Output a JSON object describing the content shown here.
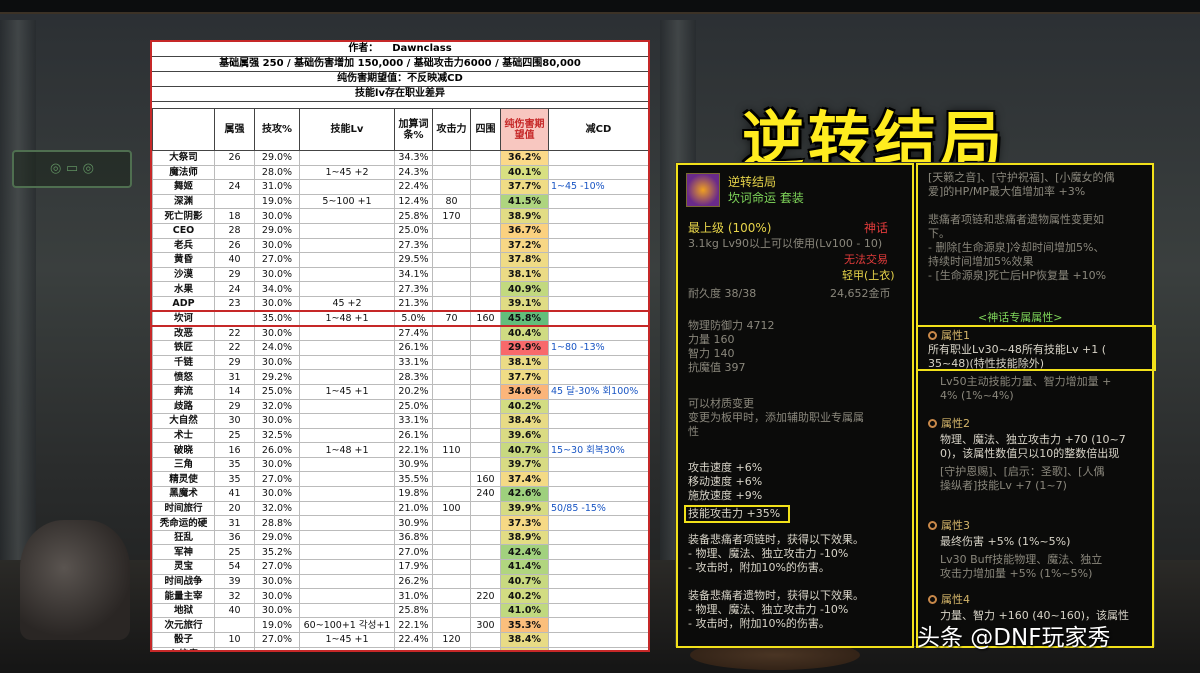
{
  "title": "逆转结局",
  "watermark": "头条 @DNF玩家秀",
  "background": {
    "sign": "◎ ▭ ◎"
  },
  "sheet": {
    "author_label": "作者：",
    "author": "Dawnclass",
    "base_line": "基础属强  250 / 基础伤害增加 150,000 / 基础攻击力6000 / 基础四围80,000",
    "pure_line": "纯伤害期望值：不反映减CD",
    "note_line": "技能lv存在职业差异",
    "columns": [
      "",
      "属强",
      "技攻%",
      "技能Lv",
      "加算词条%",
      "攻击力",
      "四围",
      "纯伤害期望值",
      "减CD"
    ],
    "rows": [
      {
        "name": "大祭司",
        "c": [
          "26",
          "29.0%",
          "",
          "34.3%",
          "",
          "",
          "36.2%",
          ""
        ],
        "color": "#fbd989"
      },
      {
        "name": "魔法师",
        "c": [
          "",
          "28.0%",
          "1~45 +2",
          "24.3%",
          "",
          "",
          "40.1%",
          ""
        ],
        "color": "#d8e081"
      },
      {
        "name": "舞姬",
        "c": [
          "24",
          "31.0%",
          "",
          "22.4%",
          "",
          "",
          "37.7%",
          "1~45 -10%"
        ],
        "color": "#f0dc85"
      },
      {
        "name": "深渊",
        "c": [
          "",
          "19.0%",
          "5~100 +1",
          "12.4%",
          "80",
          "",
          "41.5%",
          ""
        ],
        "color": "#aed57f"
      },
      {
        "name": "死亡阴影",
        "c": [
          "18",
          "30.0%",
          "",
          "25.8%",
          "170",
          "",
          "38.9%",
          ""
        ],
        "color": "#e2dc84"
      },
      {
        "name": "CEO",
        "c": [
          "28",
          "29.0%",
          "",
          "25.0%",
          "",
          "",
          "36.7%",
          ""
        ],
        "color": "#fbd17f"
      },
      {
        "name": "老兵",
        "c": [
          "26",
          "30.0%",
          "",
          "27.3%",
          "",
          "",
          "37.2%",
          ""
        ],
        "color": "#f8d785"
      },
      {
        "name": "黄昏",
        "c": [
          "40",
          "27.0%",
          "",
          "29.5%",
          "",
          "",
          "37.8%",
          ""
        ],
        "color": "#efdb85"
      },
      {
        "name": "沙漠",
        "c": [
          "29",
          "30.0%",
          "",
          "34.1%",
          "",
          "",
          "38.1%",
          ""
        ],
        "color": "#ebdb85"
      },
      {
        "name": "水果",
        "c": [
          "24",
          "34.0%",
          "",
          "27.3%",
          "",
          "",
          "40.9%",
          ""
        ],
        "color": "#c2d97f"
      },
      {
        "name": "ADP",
        "c": [
          "23",
          "30.0%",
          "45 +2",
          "21.3%",
          "",
          "",
          "39.1%",
          ""
        ],
        "color": "#e0dc84"
      },
      {
        "name": "坎诃",
        "c": [
          "",
          "35.0%",
          "1~48 +1",
          "5.0%",
          "70",
          "160",
          "45.8%",
          ""
        ],
        "color": "#63be7b",
        "hl": true
      },
      {
        "name": "改恶",
        "c": [
          "22",
          "30.0%",
          "",
          "27.4%",
          "",
          "",
          "40.4%",
          ""
        ],
        "color": "#cfdb82"
      },
      {
        "name": "铁匠",
        "c": [
          "22",
          "24.0%",
          "",
          "26.1%",
          "",
          "",
          "29.9%",
          "1~80 -13%"
        ],
        "color": "#f8696b"
      },
      {
        "name": "千链",
        "c": [
          "29",
          "30.0%",
          "",
          "33.1%",
          "",
          "",
          "38.1%",
          ""
        ],
        "color": "#ebdb85"
      },
      {
        "name": "愤怒",
        "c": [
          "31",
          "29.2%",
          "",
          "28.3%",
          "",
          "",
          "37.7%",
          ""
        ],
        "color": "#f0dc85"
      },
      {
        "name": "奔流",
        "c": [
          "14",
          "25.0%",
          "1~45 +1",
          "20.2%",
          "",
          "",
          "34.6%",
          "45 달-30% 회100%"
        ],
        "color": "#fbb57a"
      },
      {
        "name": "歧路",
        "c": [
          "29",
          "32.0%",
          "",
          "25.0%",
          "",
          "",
          "40.2%",
          ""
        ],
        "color": "#d2dc82"
      },
      {
        "name": "大自然",
        "c": [
          "30",
          "30.0%",
          "",
          "33.1%",
          "",
          "",
          "38.4%",
          ""
        ],
        "color": "#e8db85"
      },
      {
        "name": "术士",
        "c": [
          "25",
          "32.5%",
          "",
          "26.1%",
          "",
          "",
          "39.6%",
          ""
        ],
        "color": "#dadb83"
      },
      {
        "name": "破晓",
        "c": [
          "16",
          "26.0%",
          "1~48 +1",
          "22.1%",
          "110",
          "",
          "40.7%",
          "15~30 회복30%"
        ],
        "color": "#c8d980"
      },
      {
        "name": "三角",
        "c": [
          "35",
          "30.0%",
          "",
          "30.9%",
          "",
          "",
          "39.7%",
          ""
        ],
        "color": "#d8db83"
      },
      {
        "name": "精灵使",
        "c": [
          "35",
          "27.0%",
          "",
          "35.5%",
          "",
          "160",
          "37.4%",
          ""
        ],
        "color": "#f4da85"
      },
      {
        "name": "黑魔术",
        "c": [
          "41",
          "30.0%",
          "",
          "19.8%",
          "",
          "240",
          "42.6%",
          ""
        ],
        "color": "#9ed07d"
      },
      {
        "name": "时间旅行",
        "c": [
          "20",
          "32.0%",
          "",
          "21.0%",
          "100",
          "",
          "39.9%",
          "50/85 -15%"
        ],
        "color": "#d6db83"
      },
      {
        "name": "秃命运的硬",
        "c": [
          "31",
          "28.8%",
          "",
          "30.9%",
          "",
          "",
          "37.3%",
          ""
        ],
        "color": "#f6d985"
      },
      {
        "name": "狂乱",
        "c": [
          "36",
          "29.0%",
          "",
          "36.8%",
          "",
          "",
          "38.9%",
          ""
        ],
        "color": "#e2dc84"
      },
      {
        "name": "军神",
        "c": [
          "25",
          "35.2%",
          "",
          "27.0%",
          "",
          "",
          "42.4%",
          ""
        ],
        "color": "#a2d17e"
      },
      {
        "name": "灵宝",
        "c": [
          "54",
          "27.0%",
          "",
          "17.9%",
          "",
          "",
          "41.4%",
          ""
        ],
        "color": "#b1d57f"
      },
      {
        "name": "时间战争",
        "c": [
          "39",
          "30.0%",
          "",
          "26.2%",
          "",
          "",
          "40.7%",
          ""
        ],
        "color": "#c8d980"
      },
      {
        "name": "能量主宰",
        "c": [
          "32",
          "30.0%",
          "",
          "31.0%",
          "",
          "220",
          "40.2%",
          ""
        ],
        "color": "#d2dc82"
      },
      {
        "name": "地狱",
        "c": [
          "40",
          "30.0%",
          "",
          "25.8%",
          "",
          "",
          "41.0%",
          ""
        ],
        "color": "#c0d97f"
      },
      {
        "name": "次元旅行",
        "c": [
          "",
          "19.0%",
          "60~100+1 각성+1",
          "22.1%",
          "",
          "300",
          "35.3%",
          ""
        ],
        "color": "#fbbf7c"
      },
      {
        "name": "骰子",
        "c": [
          "10",
          "27.0%",
          "1~45 +1",
          "22.4%",
          "120",
          "",
          "38.4%",
          ""
        ],
        "color": "#e8db85"
      },
      {
        "name": "心绞痛",
        "c": [
          "40",
          "27.0%",
          "",
          "24.7%",
          "",
          "140",
          "38.5%",
          ""
        ],
        "color": "#e6db85"
      }
    ]
  },
  "tooltip": {
    "left": {
      "name": "逆转结局",
      "set": "坎诃命运  套装",
      "grade": "最上级  (100%)",
      "rarity": "神话",
      "weight_level": "3.1kg   Lv90以上可以使用(Lv100 - 10)",
      "trade": "无法交易",
      "slot": "轻甲(上衣)",
      "durability": "耐久度 38/38",
      "price": "24,652金币",
      "stats": [
        "物理防御力 4712",
        "力量 160",
        "智力 140",
        "抗魔值 397"
      ],
      "material": [
        "可以材质变更",
        "变更为板甲时，添加辅助职业专属属",
        "性"
      ],
      "speeds": [
        "攻击速度 +6%",
        "移动速度 +6%",
        "施放速度 +9%"
      ],
      "skill_atk": "技能攻击力 +35%",
      "necklace": [
        "装备悲痛者项链时，获得以下效果。",
        "- 物理、魔法、独立攻击力 -10%",
        "- 攻击时，附加10%的伤害。"
      ],
      "relic": [
        "装备悲痛者遗物时，获得以下效果。",
        "- 物理、魔法、独立攻击力 -10%",
        "- 攻击时，附加10%的伤害。"
      ]
    },
    "right": {
      "top": [
        "[天籁之音]、[守护祝福]、[小魔女的偶",
        "爱]的HP/MP最大值增加率 +3%"
      ],
      "desc": [
        "悲痛者项链和悲痛者遗物属性变更如",
        "下。",
        "- 删除[生命源泉]冷却时间增加5%、",
        "持续时间增加5%效果",
        "- [生命源泉]死亡后HP恢复量 +10%"
      ],
      "myth_header": "<神话专属属性>",
      "a1": "属性1",
      "a1_text": [
        "所有职业Lv30~48所有技能Lv +1 (",
        "35~48)(特性技能除外)"
      ],
      "a1b": [
        "Lv50主动技能力量、智力增加量 +",
        "4% (1%~4%)"
      ],
      "a2": "属性2",
      "a2_text": [
        "物理、魔法、独立攻击力 +70 (10~7",
        "0)，该属性数值只以10的整数倍出现"
      ],
      "a2b": [
        "[守护恩赐]、[启示：圣歌]、[人偶",
        "操纵者]技能Lv +7 (1~7)"
      ],
      "a3": "属性3",
      "a3_text": [
        "最终伤害 +5% (1%~5%)"
      ],
      "a3b": [
        "Lv30 Buff技能物理、魔法、独立",
        "攻击力增加量 +5% (1%~5%)"
      ],
      "a4": "属性4",
      "a4_text": [
        "力量、智力 +160 (40~160)，该属性"
      ]
    }
  }
}
